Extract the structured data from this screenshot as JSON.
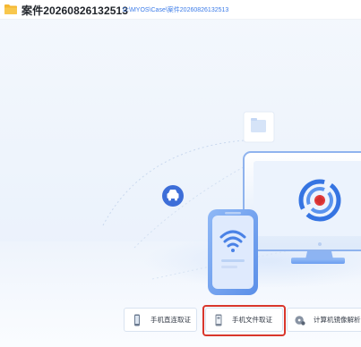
{
  "header": {
    "case_title": "案件20260826132513",
    "case_path": "D:\\MYOS\\Case\\案件20260826132513"
  },
  "icons": {
    "folder": "folder-icon",
    "car": "car-icon",
    "wifi": "wifi-icon",
    "target": "target-icon",
    "file_card": "file-icon"
  },
  "actions": {
    "phone_direct": "手机直连取证",
    "phone_file": "手机文件取证",
    "pc_image": "计算机镜像解析"
  },
  "colors": {
    "accent": "#3b7be8",
    "highlight": "#d9372c",
    "folder": "#f5b731"
  }
}
